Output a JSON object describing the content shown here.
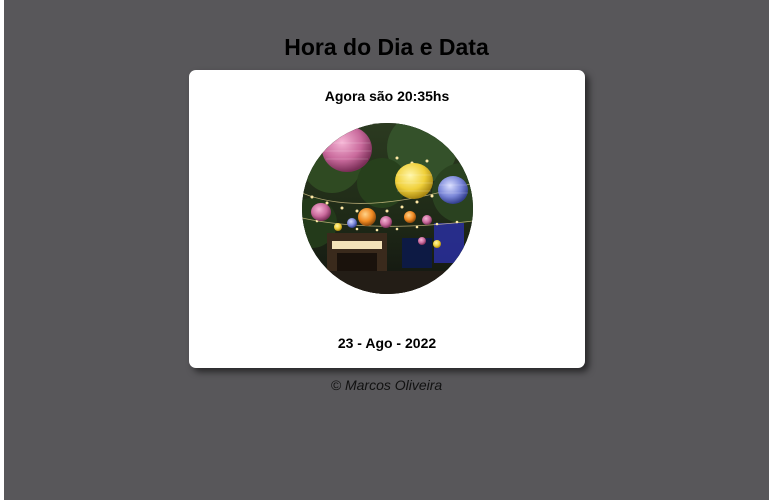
{
  "header": {
    "title": "Hora do Dia e Data"
  },
  "card": {
    "time_prefix": "Agora são ",
    "time_value": "20:35hs",
    "image": {
      "icon": "night-lanterns-photo"
    },
    "date": {
      "day": "23",
      "separator": " - ",
      "month": "Ago",
      "year": "2022"
    }
  },
  "footer": {
    "copyright": "© Marcos Oliveira"
  },
  "colors": {
    "background": "#58575a",
    "card": "#ffffff",
    "text": "#000000"
  }
}
